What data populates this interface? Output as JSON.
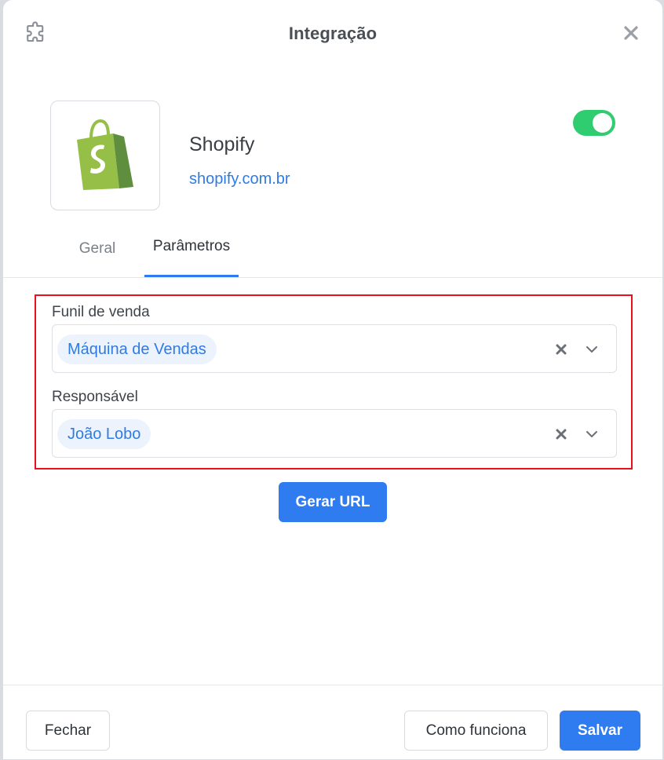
{
  "header": {
    "title": "Integração"
  },
  "app": {
    "name": "Shopify",
    "link": "shopify.com.br",
    "enabled": true
  },
  "tabs": [
    {
      "label": "Geral",
      "active": false
    },
    {
      "label": "Parâmetros",
      "active": true
    }
  ],
  "fields": {
    "funnel": {
      "label": "Funil de venda",
      "value": "Máquina de Vendas"
    },
    "owner": {
      "label": "Responsável",
      "value": "João Lobo"
    }
  },
  "actions": {
    "generate_url": "Gerar URL"
  },
  "footer": {
    "close": "Fechar",
    "how_it_works": "Como funciona",
    "save": "Salvar"
  },
  "colors": {
    "primary": "#2f7bf0",
    "toggle_on": "#2fcc70",
    "highlight_border": "#e8101a",
    "link": "#2e7be4"
  },
  "icons": {
    "header": "puzzle-icon",
    "close": "close-icon",
    "logo": "shopify-bag-icon"
  }
}
